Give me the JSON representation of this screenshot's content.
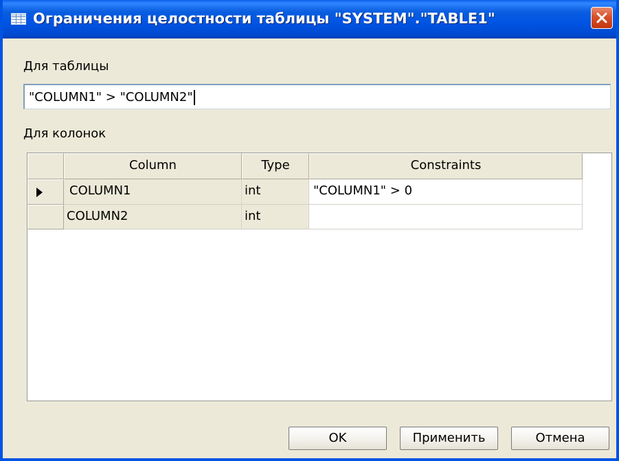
{
  "window": {
    "title": "Ограничения целостности таблицы \"SYSTEM\".\"TABLE1\""
  },
  "table_section": {
    "label": "Для таблицы",
    "constraint_value": "\"COLUMN1\" > \"COLUMN2\""
  },
  "columns_section": {
    "label": "Для колонок",
    "headers": [
      "Column",
      "Type",
      "Constraints"
    ],
    "rows": [
      {
        "column": "COLUMN1",
        "type": "int",
        "constraints": "\"COLUMN1\" > 0",
        "current": true
      },
      {
        "column": "COLUMN2",
        "type": "int",
        "constraints": "",
        "current": false
      }
    ]
  },
  "buttons": {
    "ok": "OK",
    "apply": "Применить",
    "cancel": "Отмена"
  },
  "icons": {
    "title_icon": "table-grid-icon",
    "close": "close-icon",
    "current_row": "row-pointer-icon"
  },
  "colors": {
    "titlebar": "#0054e3",
    "close_button": "#d6512b",
    "window_face": "#ece9d8"
  }
}
